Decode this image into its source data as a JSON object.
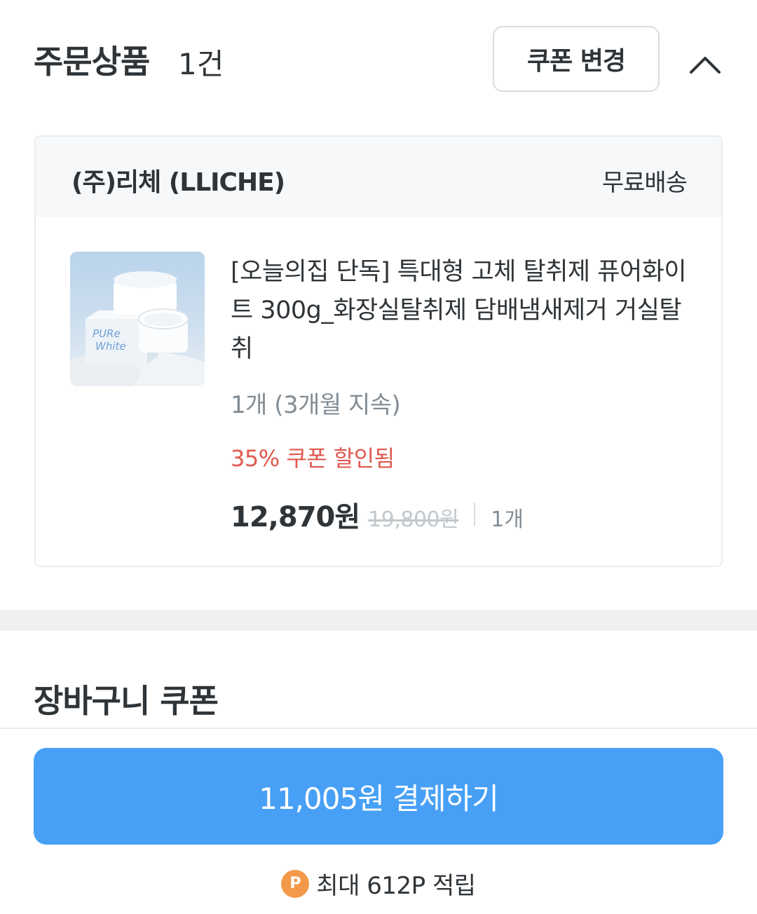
{
  "order": {
    "title": "주문상품",
    "count": "1건",
    "coupon_change_label": "쿠폰 변경",
    "collapse_icon": "chevron-up-icon"
  },
  "seller": {
    "name": "(주)리체 (LLICHE)",
    "shipping": "무료배송"
  },
  "product": {
    "title": "[오늘의집 단독] 특대형 고체 탈취제 퓨어화이트 300g_화장실탈취제 담배냄새제거 거실탈취",
    "option": "1개 (3개월 지속)",
    "coupon_applied": "35% 쿠폰 할인됨",
    "sale_price": "12,870원",
    "original_price": "19,800원",
    "quantity": "1개",
    "thumbnail_label_1": "PURe",
    "thumbnail_label_2": "White"
  },
  "cart_coupon": {
    "title": "장바구니 쿠폰"
  },
  "checkout": {
    "pay_label": "11,005원 결제하기",
    "point_badge": "P",
    "points_text": "최대 612P 적립"
  },
  "colors": {
    "accent": "#47a0f5",
    "discount": "#e0584e",
    "point_badge": "#f29a4a"
  }
}
